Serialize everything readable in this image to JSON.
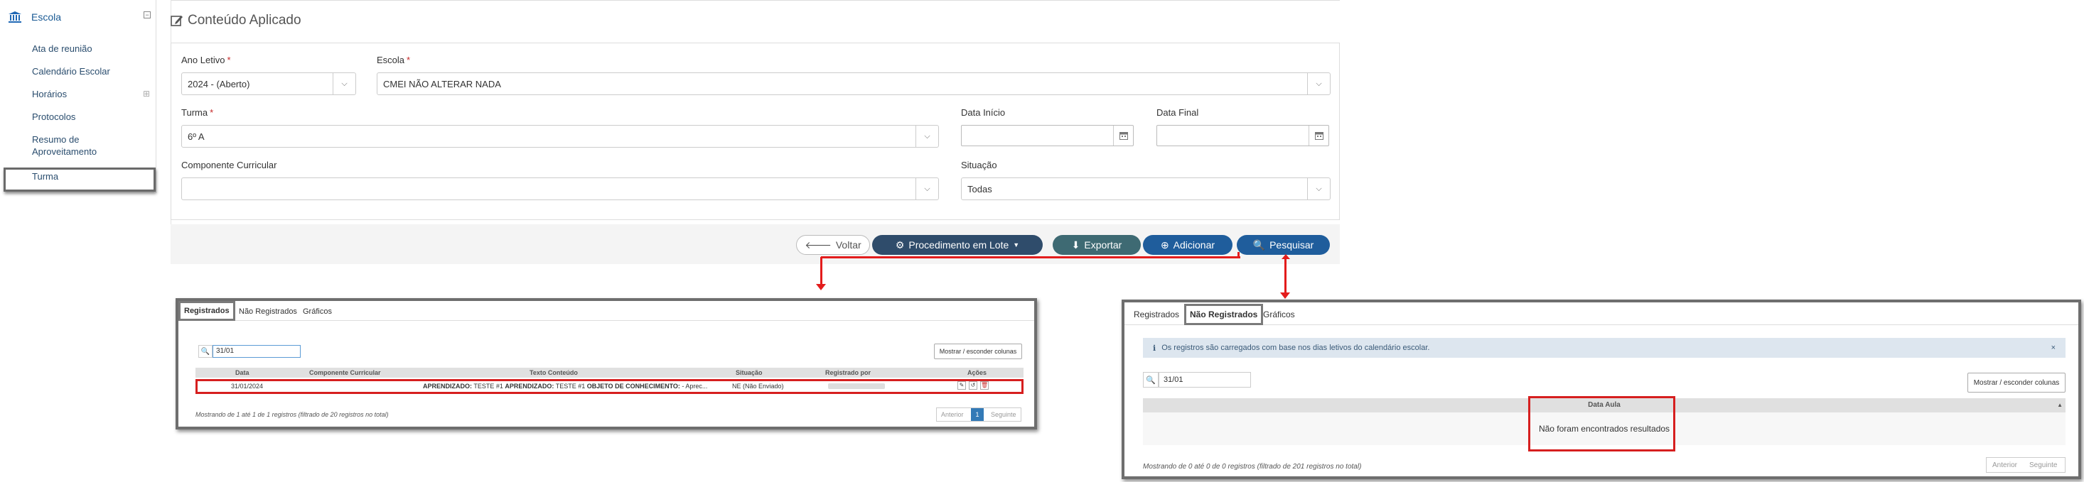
{
  "sidebar": {
    "section_title": "Escola",
    "items": [
      {
        "label": "Ata de reunião"
      },
      {
        "label": "Calendário Escolar"
      },
      {
        "label": "Horários"
      },
      {
        "label": "Protocolos"
      },
      {
        "label": "Resumo de"
      },
      {
        "label": "Aproveitamento"
      },
      {
        "label": "Turma"
      }
    ]
  },
  "page": {
    "title": "Conteúdo Aplicado"
  },
  "form": {
    "ano_letivo": {
      "label": "Ano Letivo",
      "value": "2024 - (Aberto)"
    },
    "escola": {
      "label": "Escola",
      "value": "CMEI NÃO ALTERAR NADA"
    },
    "turma": {
      "label": "Turma",
      "value": "6º A"
    },
    "data_inicio": {
      "label": "Data Início",
      "value": ""
    },
    "data_final": {
      "label": "Data Final",
      "value": ""
    },
    "componente": {
      "label": "Componente Curricular",
      "value": ""
    },
    "situacao": {
      "label": "Situação",
      "value": "Todas"
    },
    "required_mark": "*"
  },
  "actions": {
    "voltar": "Voltar",
    "lote": "Procedimento em Lote",
    "exportar": "Exportar",
    "adicionar": "Adicionar",
    "pesquisar": "Pesquisar"
  },
  "registrados_panel": {
    "tabs": [
      "Registrados",
      "Não Registrados",
      "Gráficos"
    ],
    "search_value": "31/01",
    "toggle_columns": "Mostrar / esconder colunas",
    "columns": [
      "Data",
      "Componente Curricular",
      "Texto Conteúdo",
      "Situação",
      "Registrado por",
      "Ações"
    ],
    "row": {
      "data": "31/01/2024",
      "componente": "",
      "texto": [
        {
          "bold": "APRENDIZADO:",
          "text": " TESTE #1 "
        },
        {
          "bold": "APRENDIZADO:",
          "text": " TESTE #1 "
        },
        {
          "bold": "OBJETO DE CONHECIMENTO:",
          "text": " - Aprec..."
        }
      ],
      "situacao": "NE (Não Enviado)"
    },
    "footer": "Mostrando de 1 até 1 de 1 registros (filtrado de 20 registros no total)",
    "pagination": {
      "prev": "Anterior",
      "page": "1",
      "next": "Seguinte"
    }
  },
  "nao_registrados_panel": {
    "tabs": [
      "Registrados",
      "Não Registrados",
      "Gráficos"
    ],
    "alert": "Os registros são carregados com base nos dias letivos do calendário escolar.",
    "search_value": "31/01",
    "toggle_columns": "Mostrar / esconder colunas",
    "column": "Data Aula",
    "empty": "Não foram encontrados resultados",
    "footer": "Mostrando de 0 até 0 de 0 registros (filtrado de 201 registros no total)",
    "pagination": {
      "prev": "Anterior",
      "next": "Seguinte"
    }
  },
  "colors": {
    "primary": "#1f5d9c",
    "dark": "#2f4c6b",
    "teal": "#3e6a73",
    "highlight": "#d61f1f"
  }
}
